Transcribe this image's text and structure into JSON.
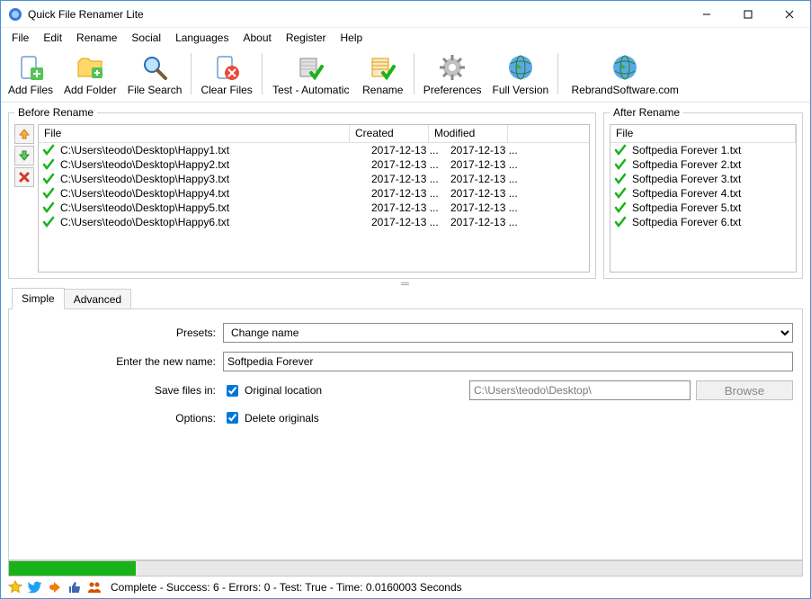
{
  "window": {
    "title": "Quick File Renamer Lite"
  },
  "menu": [
    "File",
    "Edit",
    "Rename",
    "Social",
    "Languages",
    "About",
    "Register",
    "Help"
  ],
  "toolbar": [
    {
      "id": "add-files",
      "label": "Add Files"
    },
    {
      "id": "add-folder",
      "label": "Add Folder"
    },
    {
      "id": "file-search",
      "label": "File Search"
    },
    {
      "sep": true
    },
    {
      "id": "clear-files",
      "label": "Clear Files"
    },
    {
      "sep": true
    },
    {
      "id": "test-auto",
      "label": "Test - Automatic"
    },
    {
      "id": "rename",
      "label": "Rename"
    },
    {
      "sep": true
    },
    {
      "id": "preferences",
      "label": "Preferences"
    },
    {
      "id": "full-version",
      "label": "Full Version"
    },
    {
      "sep": true
    },
    {
      "id": "rebrand",
      "label": "RebrandSoftware.com"
    }
  ],
  "panes": {
    "before_title": "Before Rename",
    "after_title": "After Rename",
    "columns": {
      "file": "File",
      "created": "Created",
      "modified": "Modified"
    },
    "before_rows": [
      {
        "file": "C:\\Users\\teodo\\Desktop\\Happy1.txt",
        "created": "2017-12-13 ...",
        "modified": "2017-12-13 ..."
      },
      {
        "file": "C:\\Users\\teodo\\Desktop\\Happy2.txt",
        "created": "2017-12-13 ...",
        "modified": "2017-12-13 ..."
      },
      {
        "file": "C:\\Users\\teodo\\Desktop\\Happy3.txt",
        "created": "2017-12-13 ...",
        "modified": "2017-12-13 ..."
      },
      {
        "file": "C:\\Users\\teodo\\Desktop\\Happy4.txt",
        "created": "2017-12-13 ...",
        "modified": "2017-12-13 ..."
      },
      {
        "file": "C:\\Users\\teodo\\Desktop\\Happy5.txt",
        "created": "2017-12-13 ...",
        "modified": "2017-12-13 ..."
      },
      {
        "file": "C:\\Users\\teodo\\Desktop\\Happy6.txt",
        "created": "2017-12-13 ...",
        "modified": "2017-12-13 ..."
      }
    ],
    "after_rows": [
      {
        "file": "Softpedia Forever 1.txt"
      },
      {
        "file": "Softpedia Forever 2.txt"
      },
      {
        "file": "Softpedia Forever 3.txt"
      },
      {
        "file": "Softpedia Forever 4.txt"
      },
      {
        "file": "Softpedia Forever 5.txt"
      },
      {
        "file": "Softpedia Forever 6.txt"
      }
    ]
  },
  "tabs": {
    "simple": "Simple",
    "advanced": "Advanced"
  },
  "form": {
    "presets_label": "Presets:",
    "presets_value": "Change name",
    "newname_label": "Enter the new name:",
    "newname_value": "Softpedia Forever ",
    "savein_label": "Save files in:",
    "original_location": "Original location",
    "path_value": "C:\\Users\\teodo\\Desktop\\",
    "browse_label": "Browse",
    "options_label": "Options:",
    "delete_originals": "Delete originals"
  },
  "progress": {
    "percent": 16
  },
  "status": {
    "text": "Complete - Success: 6 - Errors: 0 - Test: True - Time: 0.0160003 Seconds"
  }
}
